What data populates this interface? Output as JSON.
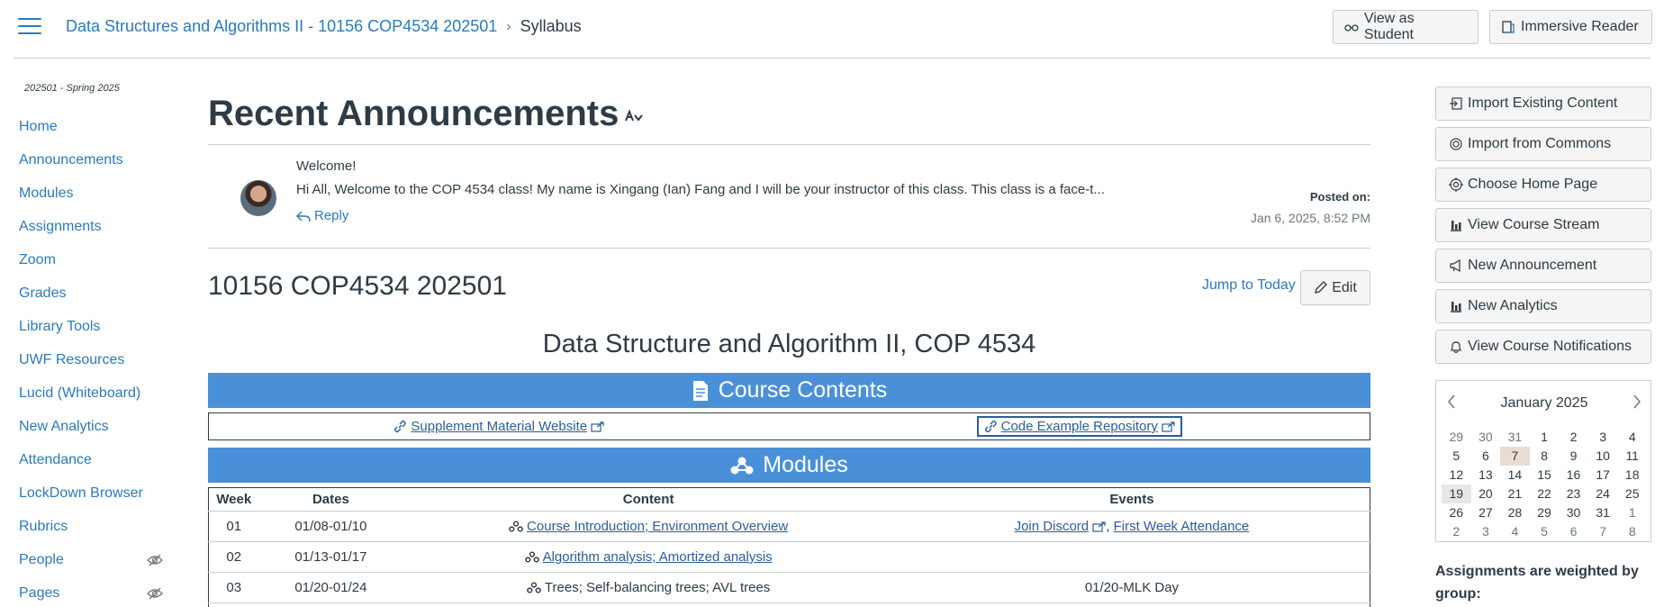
{
  "header": {
    "course_name": "Data Structures and Algorithms II - 10156 COP4534 202501",
    "breadcrumb_sep": "›",
    "current_page": "Syllabus",
    "view_as_student": "View as Student",
    "immersive_reader": "Immersive Reader"
  },
  "sidebar": {
    "term": "202501 - Spring 2025",
    "items": [
      {
        "label": "Home"
      },
      {
        "label": "Announcements"
      },
      {
        "label": "Modules"
      },
      {
        "label": "Assignments"
      },
      {
        "label": "Zoom"
      },
      {
        "label": "Grades"
      },
      {
        "label": "Library Tools"
      },
      {
        "label": "UWF Resources"
      },
      {
        "label": "Lucid (Whiteboard)"
      },
      {
        "label": "New Analytics"
      },
      {
        "label": "Attendance"
      },
      {
        "label": "LockDown Browser"
      },
      {
        "label": "Rubrics"
      },
      {
        "label": "People",
        "hidden_icon": "eye-slash-icon"
      },
      {
        "label": "Pages",
        "hidden_icon": "eye-slash-icon"
      }
    ]
  },
  "announcements": {
    "title": "Recent Announcements",
    "item": {
      "subject": "Welcome!",
      "body": "Hi All,  Welcome to the COP 4534 class! My name is Xingang (Ian) Fang and I will be your instructor of this class.  This class is a face-t...",
      "reply": "Reply",
      "posted_label": "Posted on:",
      "posted_date": "Jan 6, 2025, 8:52 PM"
    }
  },
  "syllabus": {
    "course_code": "10156 COP4534 202501",
    "jump_to_today": "Jump to Today",
    "edit": "Edit",
    "title": "Data Structure and Algorithm II, COP 4534",
    "contents_band": "Course Contents",
    "links": [
      {
        "label": "Supplement Material Website"
      },
      {
        "label": "Code Example Repository"
      }
    ],
    "modules_band": "Modules",
    "table": {
      "headers": [
        "Week",
        "Dates",
        "Content",
        "Events"
      ],
      "rows": [
        {
          "week": "01",
          "dates": "01/08-01/10",
          "content": "Course Introduction; Environment Overview",
          "content_link": true,
          "events": [
            {
              "label": "Join Discord",
              "link": true
            },
            {
              "label": "First Week Attendance",
              "link": true
            }
          ]
        },
        {
          "week": "02",
          "dates": "01/13-01/17",
          "content": "Algorithm analysis; Amortized analysis",
          "content_link": true,
          "events": []
        },
        {
          "week": "03",
          "dates": "01/20-01/24",
          "content": "Trees; Self-balancing trees; AVL trees",
          "content_link": false,
          "events": [
            {
              "label": "01/20-MLK Day",
              "link": false
            }
          ]
        }
      ]
    }
  },
  "right_sidebar": {
    "buttons": [
      {
        "label": "Import Existing Content",
        "icon": "import-icon"
      },
      {
        "label": "Import from Commons",
        "icon": "commons-icon"
      },
      {
        "label": "Choose Home Page",
        "icon": "target-icon"
      },
      {
        "label": "View Course Stream",
        "icon": "bar-chart-icon"
      },
      {
        "label": "New Announcement",
        "icon": "megaphone-icon"
      },
      {
        "label": "New Analytics",
        "icon": "bar-chart-icon"
      },
      {
        "label": "View Course Notifications",
        "icon": "bell-icon"
      }
    ],
    "calendar": {
      "month": "January 2025",
      "days": [
        [
          "29",
          "30",
          "31",
          "1",
          "2",
          "3",
          "4"
        ],
        [
          "5",
          "6",
          "7",
          "8",
          "9",
          "10",
          "11"
        ],
        [
          "12",
          "13",
          "14",
          "15",
          "16",
          "17",
          "18"
        ],
        [
          "19",
          "20",
          "21",
          "22",
          "23",
          "24",
          "25"
        ],
        [
          "26",
          "27",
          "28",
          "29",
          "30",
          "31",
          "1"
        ],
        [
          "2",
          "3",
          "4",
          "5",
          "6",
          "7",
          "8"
        ]
      ]
    },
    "weights_heading": "Assignments are weighted by group:"
  },
  "colors": {
    "link": "#2b7abc",
    "band": "#4a90d9",
    "text": "#2d3b45"
  }
}
